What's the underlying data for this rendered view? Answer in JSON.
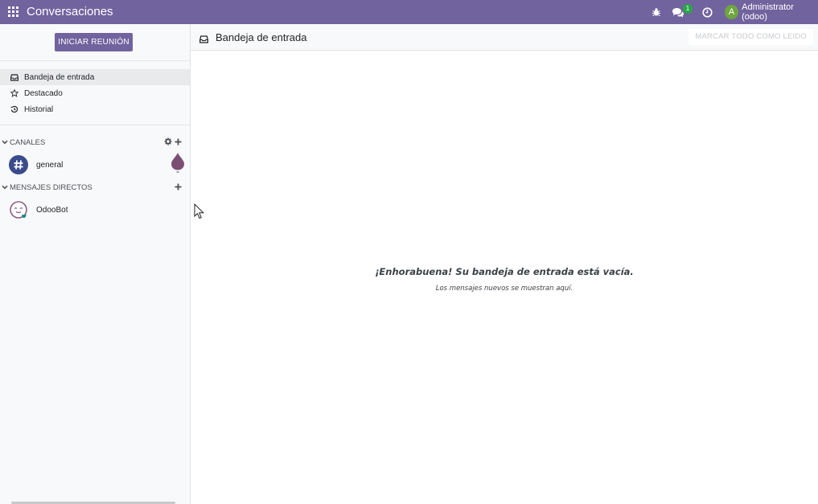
{
  "navbar": {
    "app_title": "Conversaciones",
    "chat_badge": "1",
    "user_initial": "A",
    "user_name": "Administrator (odoo)",
    "icons": [
      "apps-grid-icon",
      "bug-icon",
      "comments-icon",
      "clock-icon"
    ],
    "colors": {
      "brand": "#71639e",
      "badge": "#28a745",
      "avatar": "#6fa53f"
    }
  },
  "sidebar": {
    "meeting_button": "INICIAR REUNIÓN",
    "mailboxes": [
      {
        "label": "Bandeja de entrada",
        "icon": "inbox-icon",
        "active": true
      },
      {
        "label": "Destacado",
        "icon": "star-icon",
        "active": false
      },
      {
        "label": "Historial",
        "icon": "history-icon",
        "active": false
      }
    ],
    "categories": {
      "channels": {
        "label": "CANALES",
        "items": [
          {
            "name": "general",
            "icon": "hashtag-icon"
          }
        ]
      },
      "direct": {
        "label": "MENSAJES DIRECTOS",
        "items": [
          {
            "name": "OdooBot",
            "icon": "odoobot-avatar-icon"
          }
        ]
      }
    }
  },
  "main": {
    "title": "Bandeja de entrada",
    "mark_all_button": "MARCAR TODO COMO LEIDO",
    "empty_title": "¡Enhorabuena! Su bandeja de entrada está vacía.",
    "empty_subtitle": "Los mensajes nuevos se muestran aquí."
  }
}
